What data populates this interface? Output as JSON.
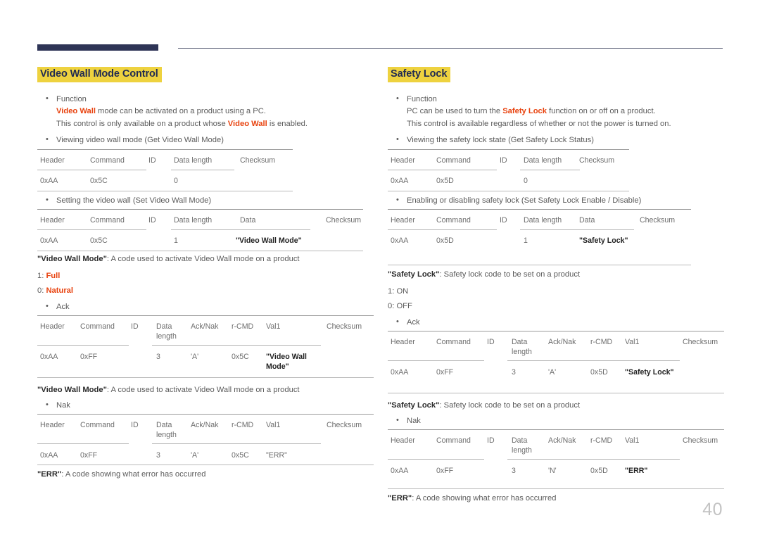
{
  "page": {
    "number": "40"
  },
  "columns": {
    "left": {
      "title": "Video Wall Mode Control",
      "function_label": "Function",
      "function_lines": [
        {
          "pre": "",
          "em": "Video Wall",
          "post": " mode can be activated on a product using a PC."
        },
        {
          "pre": "This control is only available on a product whose ",
          "em": "Video Wall",
          "post": " is enabled."
        }
      ],
      "get_bullet": "Viewing video wall mode (Get Video Wall Mode)",
      "get_table": {
        "headers": [
          "Header",
          "Command",
          "ID",
          "Data length",
          "Checksum"
        ],
        "values": [
          "0xAA",
          "0x5C",
          "",
          "0",
          ""
        ]
      },
      "set_bullet": "Setting the video wall (Set Video Wall Mode)",
      "set_table": {
        "headers": [
          "Header",
          "Command",
          "ID",
          "Data length",
          "Data",
          "Checksum"
        ],
        "values": [
          "0xAA",
          "0x5C",
          "",
          "1",
          "\"Video Wall Mode\"",
          ""
        ]
      },
      "code_note_1": {
        "term": "\"Video Wall Mode\"",
        "rest": ": A code used to activate Video Wall mode on a product"
      },
      "options": [
        {
          "key": "1: ",
          "value": "Full"
        },
        {
          "key": "0: ",
          "value": "Natural"
        }
      ],
      "ack_bullet": "Ack",
      "ack_table": {
        "headers": [
          "Header",
          "Command",
          "ID",
          "Data\nlength",
          "Ack/Nak",
          "r-CMD",
          "Val1",
          "Checksum"
        ],
        "values": [
          "0xAA",
          "0xFF",
          "",
          "3",
          "'A'",
          "0x5C",
          "\"Video Wall\nMode\"",
          ""
        ]
      },
      "code_note_2": {
        "term": "\"Video Wall Mode\"",
        "rest": ": A code used to activate Video Wall mode on a product"
      },
      "nak_bullet": "Nak",
      "nak_table": {
        "headers": [
          "Header",
          "Command",
          "ID",
          "Data\nlength",
          "Ack/Nak",
          "r-CMD",
          "Val1",
          "Checksum"
        ],
        "values": [
          "0xAA",
          "0xFF",
          "",
          "3",
          "'A'",
          "0x5C",
          "\"ERR\"",
          ""
        ]
      },
      "err_note": {
        "term": "\"ERR\"",
        "rest": ": A code showing what error has occurred"
      }
    },
    "right": {
      "title": "Safety Lock",
      "function_label": "Function",
      "function_lines": [
        {
          "pre": "PC can be used to turn the ",
          "em": "Safety Lock",
          "post": " function on or off on a product."
        },
        {
          "pre": "This control is available regardless of whether or not the power is turned on.",
          "em": "",
          "post": ""
        }
      ],
      "get_bullet": "Viewing the safety lock state (Get Safety Lock Status)",
      "get_table": {
        "headers": [
          "Header",
          "Command",
          "ID",
          "Data length",
          "Checksum"
        ],
        "values": [
          "0xAA",
          "0x5D",
          "",
          "0",
          ""
        ]
      },
      "set_bullet": "Enabling or disabling safety lock (Set Safety Lock Enable / Disable)",
      "set_table": {
        "headers": [
          "Header",
          "Command",
          "ID",
          "Data length",
          "Data",
          "Checksum"
        ],
        "values": [
          "0xAA",
          "0x5D",
          "",
          "1",
          "\"Safety Lock\"",
          ""
        ]
      },
      "code_note_1": {
        "term": "\"Safety Lock\"",
        "rest": ": Safety lock code to be set on a product"
      },
      "options": [
        {
          "key": "1: ",
          "value": "ON"
        },
        {
          "key": "0: ",
          "value": "OFF"
        }
      ],
      "ack_bullet": "Ack",
      "ack_table": {
        "headers": [
          "Header",
          "Command",
          "ID",
          "Data\nlength",
          "Ack/Nak",
          "r-CMD",
          "Val1",
          "Checksum"
        ],
        "values": [
          "0xAA",
          "0xFF",
          "",
          "3",
          "'A'",
          "0x5D",
          "\"Safety Lock\"",
          ""
        ]
      },
      "code_note_2": {
        "term": "\"Safety Lock\"",
        "rest": ": Safety lock code to be set on a product"
      },
      "nak_bullet": "Nak",
      "nak_table": {
        "headers": [
          "Header",
          "Command",
          "ID",
          "Data\nlength",
          "Ack/Nak",
          "r-CMD",
          "Val1",
          "Checksum"
        ],
        "values": [
          "0xAA",
          "0xFF",
          "",
          "3",
          "'N'",
          "0x5D",
          "\"ERR\"",
          ""
        ]
      },
      "err_note": {
        "term": "\"ERR\"",
        "rest": ": A code showing what error has occurred"
      }
    }
  },
  "theme": {
    "highlight": "#eed23f",
    "title_text": "#1f2a52",
    "accent_red": "#e8420e",
    "header_bar": "#2e3456",
    "rule": "#b9b9b9"
  }
}
